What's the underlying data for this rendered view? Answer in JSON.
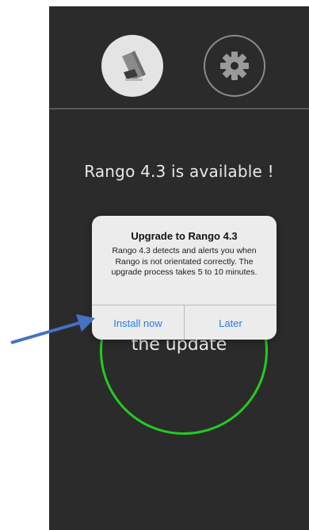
{
  "header": {
    "device_button_icon": "rango-device-icon",
    "settings_button_icon": "gear-icon"
  },
  "main": {
    "available_text": "Rango 4.3 is available !",
    "ring_text": "the update",
    "ring_color": "#22cc22"
  },
  "alert": {
    "title": "Upgrade to Rango 4.3",
    "message": "Rango 4.3 detects and alerts you when Rango is not orientated correctly. The upgrade process takes 5 to 10 minutes.",
    "install_label": "Install now",
    "later_label": "Later",
    "button_color": "#2a7ae2"
  },
  "annotation": {
    "arrow_color": "#4472c4"
  }
}
